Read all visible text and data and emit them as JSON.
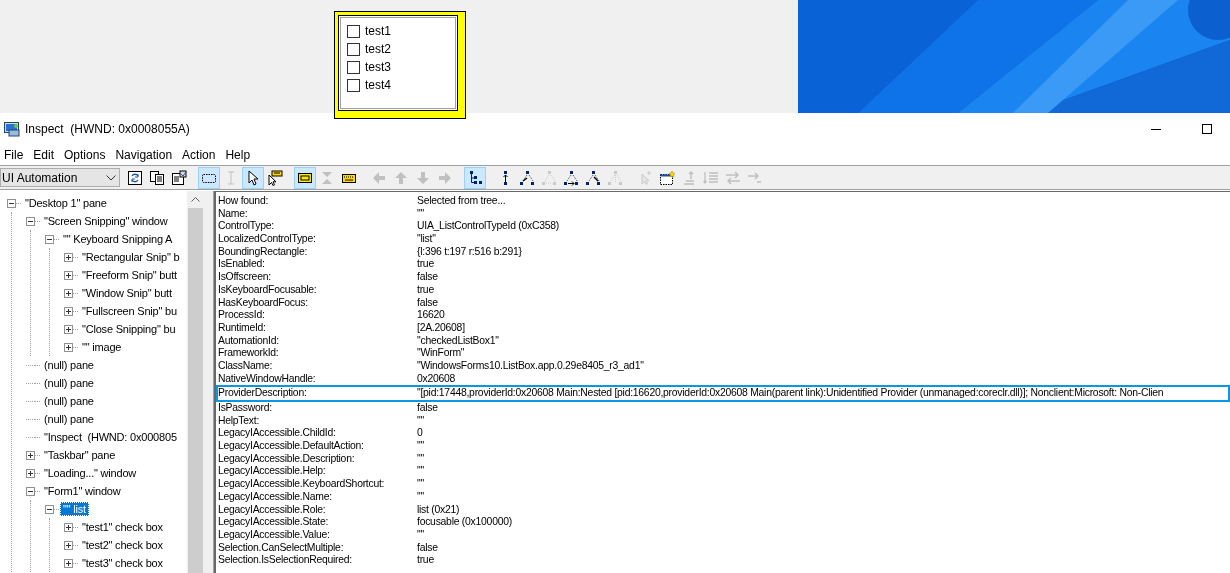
{
  "desktop_form": {
    "items": [
      {
        "label": "test1",
        "checked": false
      },
      {
        "label": "test2",
        "checked": false
      },
      {
        "label": "test3",
        "checked": false
      },
      {
        "label": "test4",
        "checked": false
      }
    ]
  },
  "window": {
    "title": "Inspect  (HWND: 0x0008055A)"
  },
  "menu": [
    "File",
    "Edit",
    "Options",
    "Navigation",
    "Action",
    "Help"
  ],
  "toolbar": {
    "mode": "UI Automation",
    "groups": [
      [
        {
          "kind": "refresh",
          "pressed": false,
          "disabled": false
        },
        {
          "kind": "copy",
          "pressed": false,
          "disabled": false
        },
        {
          "kind": "properties",
          "pressed": false,
          "disabled": false
        }
      ],
      [
        {
          "kind": "rect-select",
          "pressed": true,
          "disabled": false
        },
        {
          "kind": "text-cursor",
          "pressed": false,
          "disabled": true
        },
        {
          "kind": "pointer",
          "pressed": true,
          "disabled": false
        },
        {
          "kind": "pointer-tooltip",
          "pressed": false,
          "disabled": false
        }
      ],
      [
        {
          "kind": "highlight",
          "pressed": true,
          "disabled": false
        },
        {
          "kind": "collapse",
          "pressed": false,
          "disabled": true
        },
        {
          "kind": "keyboard",
          "pressed": false,
          "disabled": false
        }
      ],
      [
        {
          "kind": "arrow-left",
          "pressed": false,
          "disabled": true
        },
        {
          "kind": "arrow-up",
          "pressed": false,
          "disabled": true
        },
        {
          "kind": "arrow-down",
          "pressed": false,
          "disabled": true
        },
        {
          "kind": "arrow-right",
          "pressed": false,
          "disabled": true
        }
      ],
      [
        {
          "kind": "tree",
          "pressed": true,
          "disabled": false
        }
      ],
      [
        {
          "kind": "nav-parent",
          "pressed": false,
          "disabled": false
        },
        {
          "kind": "nav-first-child",
          "pressed": false,
          "disabled": false
        },
        {
          "kind": "nav-next",
          "pressed": false,
          "disabled": true
        },
        {
          "kind": "nav-last-child",
          "pressed": false,
          "disabled": false
        },
        {
          "kind": "nav-prev",
          "pressed": false,
          "disabled": false
        },
        {
          "kind": "nav-focus",
          "pressed": false,
          "disabled": true
        }
      ],
      [
        {
          "kind": "pointer-sparkle",
          "pressed": false,
          "disabled": true
        },
        {
          "kind": "window-star",
          "pressed": false,
          "disabled": false
        },
        {
          "kind": "move-up",
          "pressed": false,
          "disabled": true
        },
        {
          "kind": "list-move",
          "pressed": false,
          "disabled": true
        },
        {
          "kind": "swap",
          "pressed": false,
          "disabled": true
        },
        {
          "kind": "move-right",
          "pressed": false,
          "disabled": true
        }
      ]
    ]
  },
  "tree": [
    {
      "label": "\"Desktop 1\" pane",
      "kind": "node",
      "expanded": true,
      "selected": false,
      "children": [
        {
          "label": "\"Screen Snipping\" window",
          "kind": "node",
          "expanded": true,
          "selected": false,
          "children": [
            {
              "label": "\"\" Keyboard Snipping A",
              "kind": "node",
              "expanded": true,
              "selected": false,
              "children": [
                {
                  "label": "\"Rectangular Snip\" b",
                  "kind": "node",
                  "expanded": false,
                  "selected": false
                },
                {
                  "label": "\"Freeform Snip\" butt",
                  "kind": "node",
                  "expanded": false,
                  "selected": false
                },
                {
                  "label": "\"Window Snip\" butt",
                  "kind": "node",
                  "expanded": false,
                  "selected": false
                },
                {
                  "label": "\"Fullscreen Snip\" bu",
                  "kind": "node",
                  "expanded": false,
                  "selected": false
                },
                {
                  "label": "\"Close Snipping\" bu",
                  "kind": "node",
                  "expanded": false,
                  "selected": false
                },
                {
                  "label": "\"\" image",
                  "kind": "node",
                  "expanded": false,
                  "selected": false
                }
              ]
            }
          ]
        },
        {
          "label": "(null) pane",
          "kind": "leaf",
          "selected": false
        },
        {
          "label": "(null) pane",
          "kind": "leaf",
          "selected": false
        },
        {
          "label": "(null) pane",
          "kind": "leaf",
          "selected": false
        },
        {
          "label": "(null) pane",
          "kind": "leaf",
          "selected": false
        },
        {
          "label": "\"Inspect  (HWND: 0x000805",
          "kind": "leaf",
          "selected": false
        },
        {
          "label": "\"Taskbar\" pane",
          "kind": "node",
          "expanded": false,
          "selected": false
        },
        {
          "label": "\"Loading...\" window",
          "kind": "node",
          "expanded": false,
          "selected": false
        },
        {
          "label": "\"Form1\" window",
          "kind": "node",
          "expanded": true,
          "selected": false,
          "children": [
            {
              "label": "\"\" list",
              "kind": "node",
              "expanded": true,
              "selected": true,
              "children": [
                {
                  "label": "\"test1\" check box",
                  "kind": "node",
                  "expanded": false,
                  "selected": false
                },
                {
                  "label": "\"test2\" check box",
                  "kind": "node",
                  "expanded": false,
                  "selected": false
                },
                {
                  "label": "\"test3\" check box",
                  "kind": "node",
                  "expanded": false,
                  "selected": false
                }
              ]
            }
          ]
        }
      ]
    }
  ],
  "properties": [
    {
      "name": "How found:",
      "value": "Selected from tree...",
      "highlighted": false
    },
    {
      "name": "Name:",
      "value": "\"\"",
      "highlighted": false
    },
    {
      "name": "ControlType:",
      "value": "UIA_ListControlTypeId (0xC358)",
      "highlighted": false
    },
    {
      "name": "LocalizedControlType:",
      "value": "\"list\"",
      "highlighted": false
    },
    {
      "name": "BoundingRectangle:",
      "value": "{l:396 t:197 r:516 b:291}",
      "highlighted": false
    },
    {
      "name": "IsEnabled:",
      "value": "true",
      "highlighted": false
    },
    {
      "name": "IsOffscreen:",
      "value": "false",
      "highlighted": false
    },
    {
      "name": "IsKeyboardFocusable:",
      "value": "true",
      "highlighted": false
    },
    {
      "name": "HasKeyboardFocus:",
      "value": "false",
      "highlighted": false
    },
    {
      "name": "ProcessId:",
      "value": "16620",
      "highlighted": false
    },
    {
      "name": "RuntimeId:",
      "value": "[2A.20608]",
      "highlighted": false
    },
    {
      "name": "AutomationId:",
      "value": "\"checkedListBox1\"",
      "highlighted": false
    },
    {
      "name": "FrameworkId:",
      "value": "\"WinForm\"",
      "highlighted": false
    },
    {
      "name": "ClassName:",
      "value": "\"WindowsForms10.ListBox.app.0.29e8405_r3_ad1\"",
      "highlighted": false
    },
    {
      "name": "NativeWindowHandle:",
      "value": "0x20608",
      "highlighted": false
    },
    {
      "name": "ProviderDescription:",
      "value": "\"[pid:17448,providerId:0x20608 Main:Nested [pid:16620,providerId:0x20608 Main(parent link):Unidentified Provider (unmanaged:coreclr.dll)]; Nonclient:Microsoft: Non-Clien",
      "highlighted": true
    },
    {
      "name": "IsPassword:",
      "value": "false",
      "highlighted": false
    },
    {
      "name": "HelpText:",
      "value": "\"\"",
      "highlighted": false
    },
    {
      "name": "LegacyIAccessible.ChildId:",
      "value": "0",
      "highlighted": false
    },
    {
      "name": "LegacyIAccessible.DefaultAction:",
      "value": "\"\"",
      "highlighted": false
    },
    {
      "name": "LegacyIAccessible.Description:",
      "value": "\"\"",
      "highlighted": false
    },
    {
      "name": "LegacyIAccessible.Help:",
      "value": "\"\"",
      "highlighted": false
    },
    {
      "name": "LegacyIAccessible.KeyboardShortcut:",
      "value": "\"\"",
      "highlighted": false
    },
    {
      "name": "LegacyIAccessible.Name:",
      "value": "\"\"",
      "highlighted": false
    },
    {
      "name": "LegacyIAccessible.Role:",
      "value": "list (0x21)",
      "highlighted": false
    },
    {
      "name": "LegacyIAccessible.State:",
      "value": "focusable (0x100000)",
      "highlighted": false
    },
    {
      "name": "LegacyIAccessible.Value:",
      "value": "\"\"",
      "highlighted": false
    },
    {
      "name": "Selection.CanSelectMultiple:",
      "value": "false",
      "highlighted": false
    },
    {
      "name": "Selection.IsSelectionRequired:",
      "value": "true",
      "highlighted": false
    }
  ]
}
